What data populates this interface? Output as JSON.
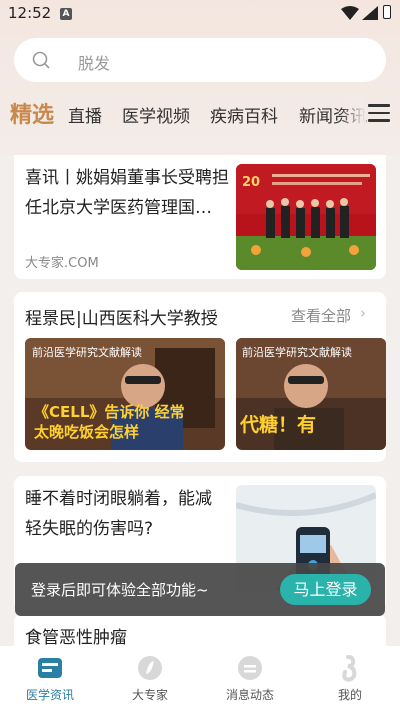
{
  "status_bar": {
    "time": "12:52",
    "notification_icon": "A"
  },
  "search": {
    "placeholder": "脱发"
  },
  "tabs": [
    "精选",
    "直播",
    "医学视频",
    "疾病百科",
    "新闻资讯"
  ],
  "articles": [
    {
      "title": "喜讯丨姚娟娟董事长受聘担任北京大学医药管理国…",
      "source": "大专家.COM"
    },
    {
      "title": "睡不着时闭眼躺着，能减轻失眠的伤害吗?"
    },
    {
      "title": "食管恶性肿瘤"
    }
  ],
  "expert_section": {
    "title": "程景民|山西医科大学教授",
    "more": "查看全部",
    "videos": [
      {
        "top_caption": "前沿医学研究文献解读",
        "overlay": "《CELL》告诉你 经常太晚吃饭会怎样"
      },
      {
        "top_caption": "前沿医学研究文献解读",
        "overlay": "代糖！有"
      }
    ]
  },
  "thumb1_screen": "首届中国医药管理学术年会",
  "toast": {
    "message": "登录后即可体验全部功能~",
    "button": "马上登录"
  },
  "bottom_nav": [
    {
      "label": "医学资讯",
      "icon": "news-icon",
      "active": true
    },
    {
      "label": "大专家",
      "icon": "expert-icon",
      "active": false
    },
    {
      "label": "消息动态",
      "icon": "message-icon",
      "active": false
    },
    {
      "label": "我的",
      "icon": "profile-icon",
      "active": false
    }
  ],
  "colors": {
    "accent": "#c8894d",
    "primary_teal": "#2ab3aa",
    "nav_active": "#2a7fa5"
  }
}
